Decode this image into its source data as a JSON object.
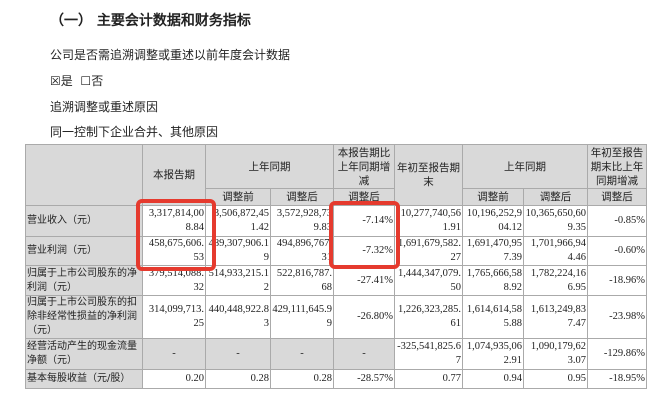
{
  "title": "（一）  主要会计数据和财务指标",
  "question": "公司是否需追溯调整或重述以前年度会计数据",
  "yes_label": "是",
  "no_label": "否",
  "yes_checked": true,
  "reason_title": "追溯调整或重述原因",
  "reason": "同一控制下企业合并、其他原因",
  "headers": {
    "current": "本报告期",
    "prev": "上年同期",
    "change": "本报告期比上年同期增减",
    "ytd": "年初至报告期末",
    "prev2": "上年同期",
    "ytd_change": "年初至报告期末比上年同期增减",
    "before": "调整前",
    "after": "调整后"
  },
  "rows": [
    {
      "label": "营业收入（元）",
      "v": [
        "3,317,814,008.84",
        "3,506,872,451.42",
        "3,572,928,739.83",
        "-7.14%",
        "10,277,740,561.91",
        "10,196,252,904.12",
        "10,365,650,609.35",
        "-0.85%"
      ]
    },
    {
      "label": "营业利润（元）",
      "v": [
        "458,675,606.53",
        "489,307,906.19",
        "494,896,767.31",
        "-7.32%",
        "1,691,679,582.27",
        "1,691,470,957.39",
        "1,701,966,944.46",
        "-0.60%"
      ]
    },
    {
      "label": "归属于上市公司股东的净利润（元）",
      "v": [
        "379,514,088.32",
        "514,933,215.12",
        "522,816,787.68",
        "-27.41%",
        "1,444,347,079.50",
        "1,765,666,588.92",
        "1,782,224,166.95",
        "-18.96%"
      ]
    },
    {
      "label": "归属于上市公司股东的扣除非经常性损益的净利润（元）",
      "v": [
        "314,099,713.25",
        "440,448,922.83",
        "429,111,645.99",
        "-26.80%",
        "1,226,323,285.61",
        "1,614,614,585.88",
        "1,613,249,837.47",
        "-23.98%"
      ]
    },
    {
      "label": "经营活动产生的现金流量净额（元）",
      "v": [
        "-",
        "-",
        "-",
        "-",
        "-325,541,825.67",
        "1,074,935,062.91",
        "1,090,179,623.07",
        "-129.86%"
      ]
    },
    {
      "label": "基本每股收益（元/股）",
      "v": [
        "0.20",
        "0.28",
        "0.28",
        "-28.57%",
        "0.77",
        "0.94",
        "0.95",
        "-18.95%"
      ]
    }
  ],
  "highlight_color": "#e53a2e"
}
